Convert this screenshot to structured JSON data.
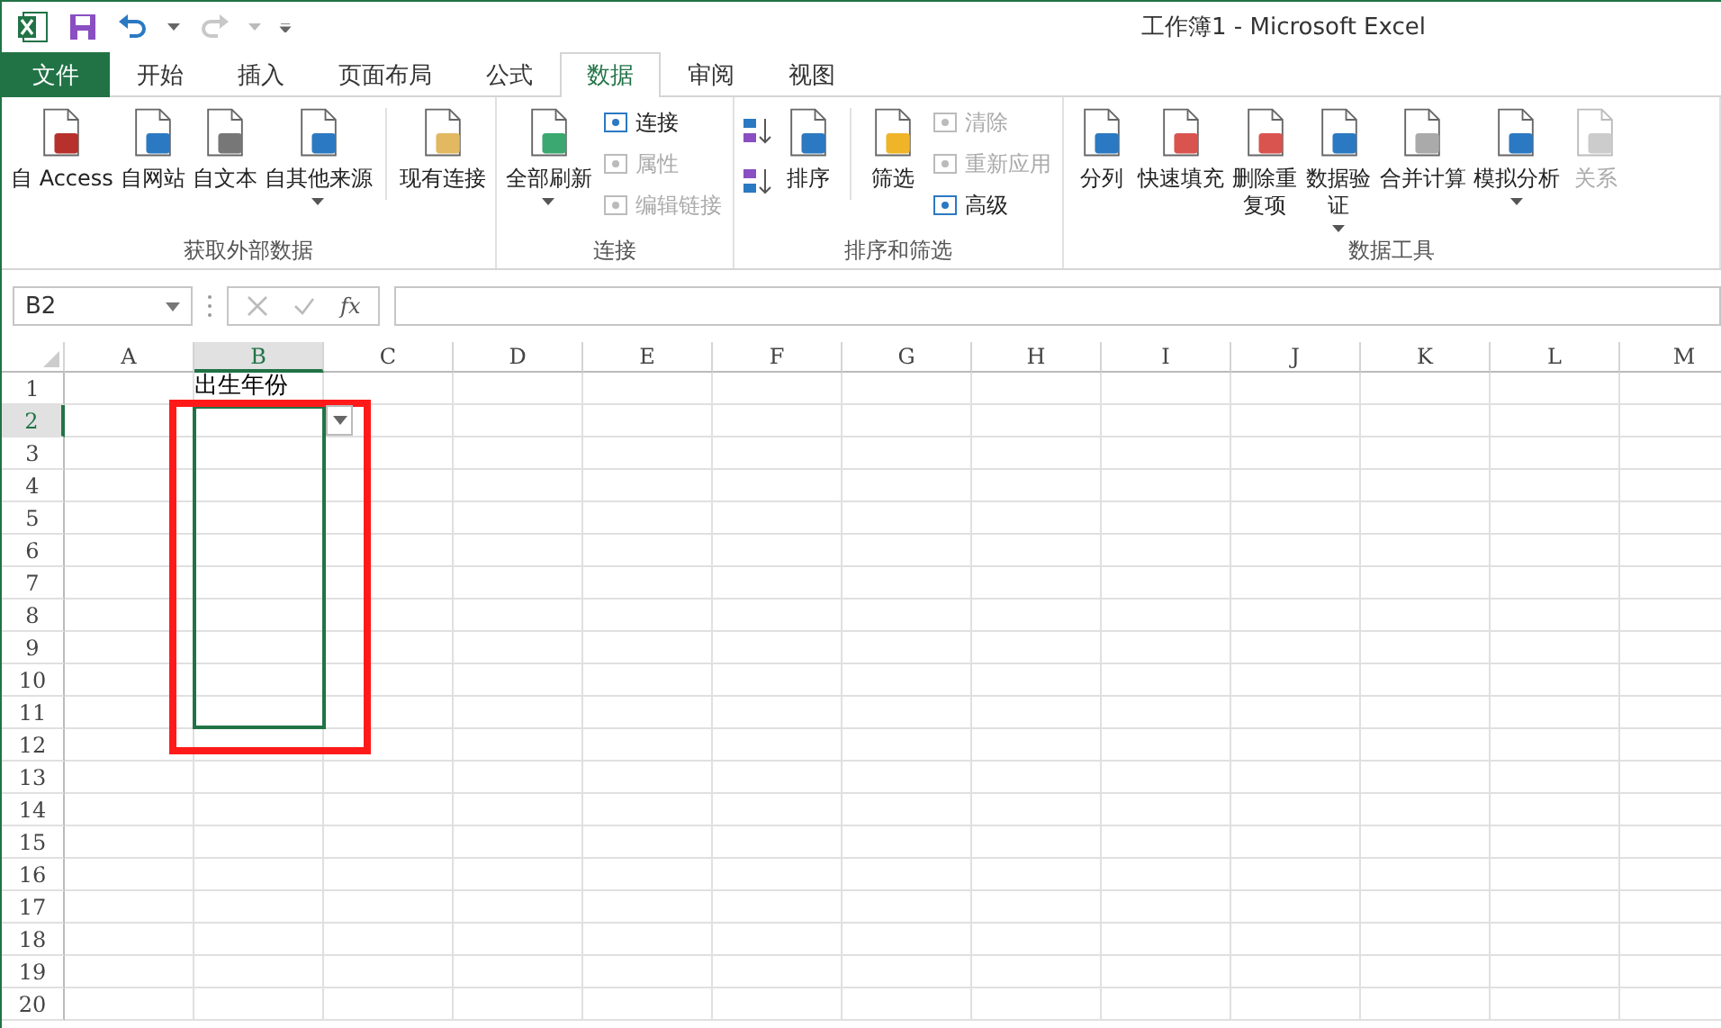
{
  "window": {
    "title": "工作簿1 - Microsoft Excel"
  },
  "quick_access": {
    "redo_disabled": true
  },
  "tabs": [
    {
      "label": "文件",
      "kind": "file",
      "selected": false
    },
    {
      "label": "开始",
      "kind": "tab",
      "selected": false
    },
    {
      "label": "插入",
      "kind": "tab",
      "selected": false
    },
    {
      "label": "页面布局",
      "kind": "tab",
      "selected": false
    },
    {
      "label": "公式",
      "kind": "tab",
      "selected": false
    },
    {
      "label": "数据",
      "kind": "tab",
      "selected": true
    },
    {
      "label": "审阅",
      "kind": "tab",
      "selected": false
    },
    {
      "label": "视图",
      "kind": "tab",
      "selected": false
    }
  ],
  "ribbon": {
    "groups": [
      {
        "label": "获取外部数据",
        "items": [
          {
            "kind": "large",
            "label": "自 Access",
            "disabled": false,
            "dropdown": false
          },
          {
            "kind": "large",
            "label": "自网站",
            "disabled": false,
            "dropdown": false
          },
          {
            "kind": "large",
            "label": "自文本",
            "disabled": false,
            "dropdown": false
          },
          {
            "kind": "large",
            "label": "自其他来源",
            "disabled": false,
            "dropdown": true
          },
          {
            "kind": "separator"
          },
          {
            "kind": "large",
            "label": "现有连接",
            "disabled": false,
            "dropdown": false
          }
        ]
      },
      {
        "label": "连接",
        "items": [
          {
            "kind": "large",
            "label": "全部刷新",
            "disabled": false,
            "dropdown": true
          },
          {
            "kind": "small",
            "label": "连接",
            "disabled": false,
            "dropdown": false
          },
          {
            "kind": "small",
            "label": "属性",
            "disabled": true,
            "dropdown": false
          },
          {
            "kind": "small",
            "label": "编辑链接",
            "disabled": true,
            "dropdown": false
          }
        ]
      },
      {
        "label": "排序和筛选",
        "items": [
          {
            "kind": "sort_pair"
          },
          {
            "kind": "large",
            "label": "排序",
            "disabled": false,
            "dropdown": false
          },
          {
            "kind": "separator"
          },
          {
            "kind": "large",
            "label": "筛选",
            "disabled": false,
            "dropdown": false
          },
          {
            "kind": "small",
            "label": "清除",
            "disabled": true,
            "dropdown": false
          },
          {
            "kind": "small",
            "label": "重新应用",
            "disabled": true,
            "dropdown": false
          },
          {
            "kind": "small",
            "label": "高级",
            "disabled": false,
            "dropdown": false
          }
        ]
      },
      {
        "label": "数据工具",
        "items": [
          {
            "kind": "large",
            "label": "分列",
            "disabled": false,
            "dropdown": false
          },
          {
            "kind": "large",
            "label": "快速填充",
            "disabled": false,
            "dropdown": false
          },
          {
            "kind": "large",
            "label": "删除重复项",
            "wrapped": true,
            "disabled": false,
            "dropdown": false
          },
          {
            "kind": "large",
            "label": "数据验证",
            "wrapped": true,
            "disabled": false,
            "dropdown": true
          },
          {
            "kind": "large",
            "label": "合并计算",
            "disabled": false,
            "dropdown": false
          },
          {
            "kind": "large",
            "label": "模拟分析",
            "disabled": false,
            "dropdown": true
          },
          {
            "kind": "large",
            "label": "关系",
            "disabled": true,
            "dropdown": false
          }
        ]
      }
    ]
  },
  "formula_bar": {
    "name_box": "B2",
    "function_label": "fx"
  },
  "sheet": {
    "columns": [
      {
        "label": "A",
        "selected": false
      },
      {
        "label": "B",
        "selected": true
      },
      {
        "label": "C",
        "selected": false
      },
      {
        "label": "D",
        "selected": false
      },
      {
        "label": "E",
        "selected": false
      },
      {
        "label": "F",
        "selected": false
      },
      {
        "label": "G",
        "selected": false
      },
      {
        "label": "H",
        "selected": false
      },
      {
        "label": "I",
        "selected": false
      },
      {
        "label": "J",
        "selected": false
      },
      {
        "label": "K",
        "selected": false
      },
      {
        "label": "L",
        "selected": false
      },
      {
        "label": "M",
        "selected": false
      }
    ],
    "rows": [
      {
        "label": "1",
        "selected": false,
        "outlined": false,
        "validation_dropdown": false,
        "column_b": "出生年份"
      },
      {
        "label": "2",
        "selected": true,
        "outlined": true,
        "validation_dropdown": true
      },
      {
        "label": "3",
        "selected": false,
        "outlined": true,
        "validation_dropdown": false
      },
      {
        "label": "4",
        "selected": false,
        "outlined": true,
        "validation_dropdown": false
      },
      {
        "label": "5",
        "selected": false,
        "outlined": true,
        "validation_dropdown": false
      },
      {
        "label": "6",
        "selected": false,
        "outlined": true,
        "validation_dropdown": false
      },
      {
        "label": "7",
        "selected": false,
        "outlined": true,
        "validation_dropdown": false
      },
      {
        "label": "8",
        "selected": false,
        "outlined": true,
        "validation_dropdown": false
      },
      {
        "label": "9",
        "selected": false,
        "outlined": true,
        "validation_dropdown": false
      },
      {
        "label": "10",
        "selected": false,
        "outlined": true,
        "validation_dropdown": false
      },
      {
        "label": "11",
        "selected": false,
        "outlined": true,
        "validation_dropdown": false
      },
      {
        "label": "12",
        "selected": false,
        "outlined": false,
        "validation_dropdown": false
      },
      {
        "label": "13",
        "selected": false,
        "outlined": false,
        "validation_dropdown": false
      },
      {
        "label": "14",
        "selected": false,
        "outlined": false,
        "validation_dropdown": false
      },
      {
        "label": "15",
        "selected": false,
        "outlined": false,
        "validation_dropdown": false
      },
      {
        "label": "16",
        "selected": false,
        "outlined": false,
        "validation_dropdown": false
      },
      {
        "label": "17",
        "selected": false,
        "outlined": false,
        "validation_dropdown": false
      },
      {
        "label": "18",
        "selected": false,
        "outlined": false,
        "validation_dropdown": false
      },
      {
        "label": "19",
        "selected": false,
        "outlined": false,
        "validation_dropdown": false
      },
      {
        "label": "20",
        "selected": false,
        "outlined": false,
        "validation_dropdown": false
      }
    ],
    "highlight_box": true
  }
}
